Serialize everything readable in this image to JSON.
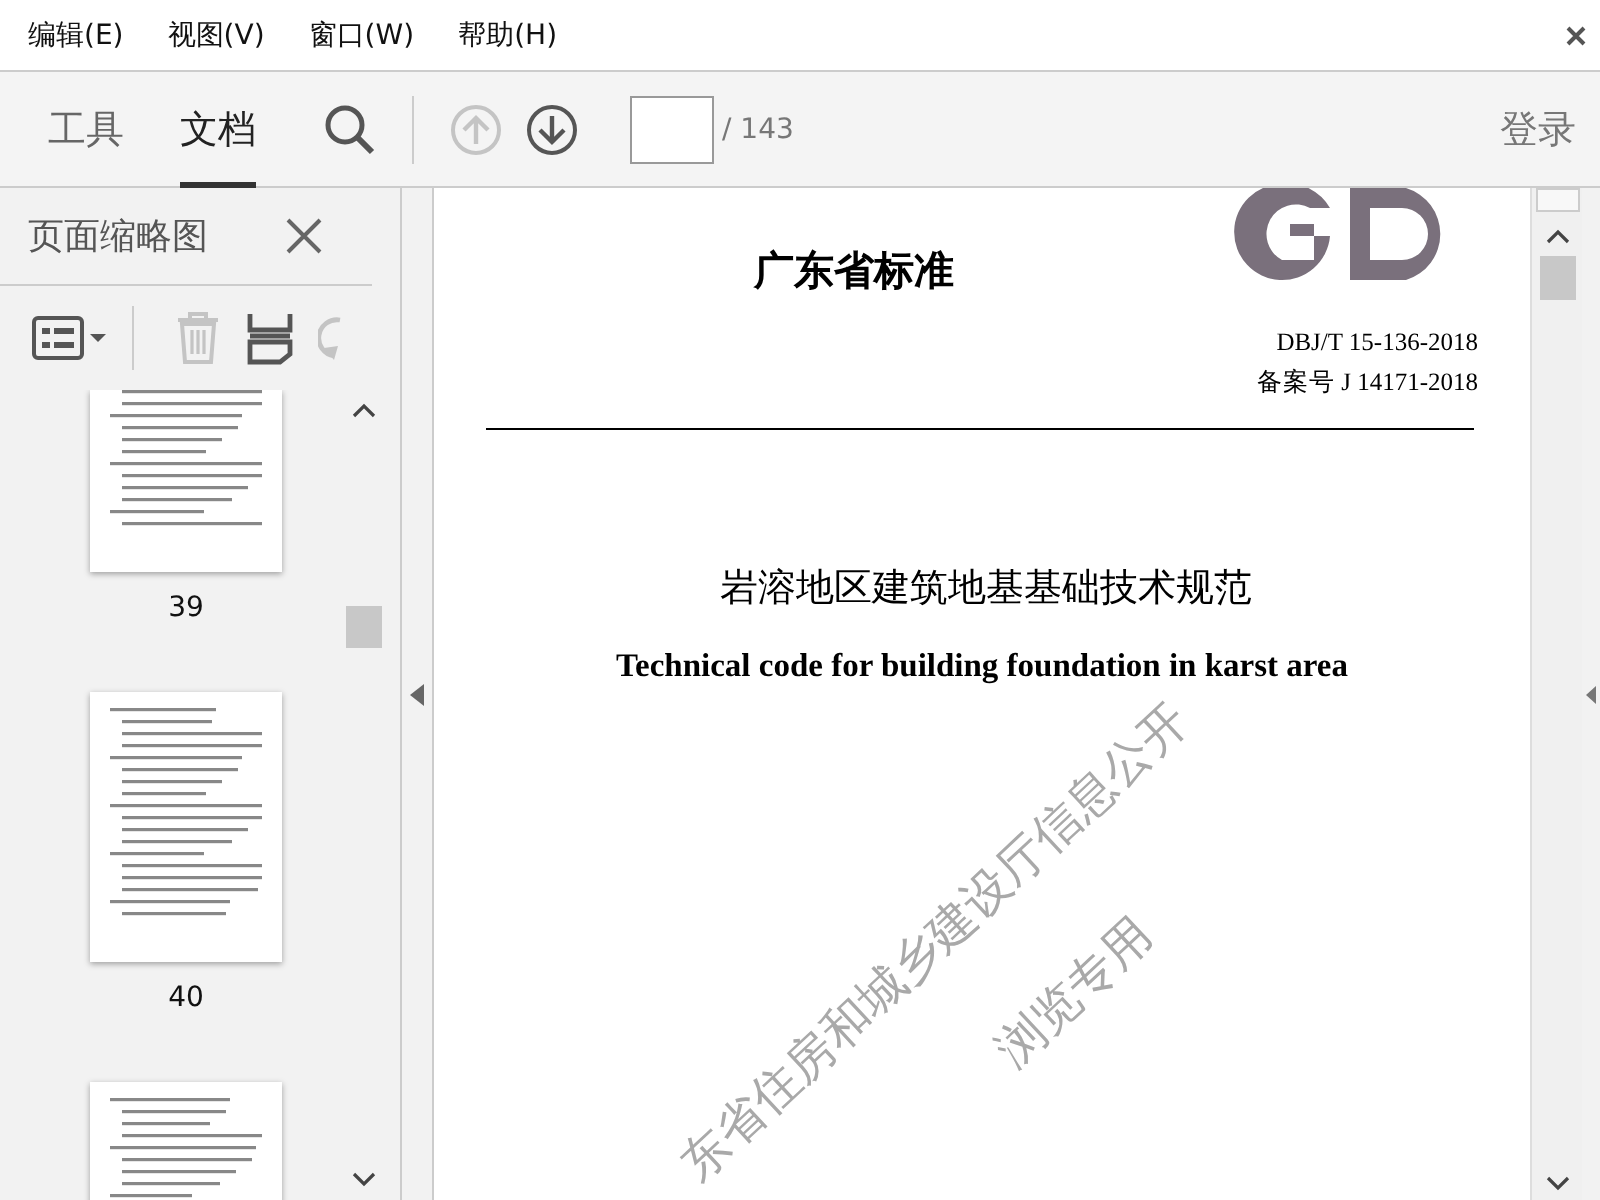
{
  "menu": [
    {
      "label": "编辑(E)"
    },
    {
      "label": "视图(V)"
    },
    {
      "label": "窗口(W)"
    },
    {
      "label": "帮助(H)"
    }
  ],
  "toolbar": {
    "tabs": [
      {
        "label": "工具",
        "selected": false
      },
      {
        "label": "文档",
        "selected": true
      }
    ],
    "prev_page_disabled": true,
    "next_page_disabled": false,
    "page_total": "/ 143",
    "login": "登录"
  },
  "thumbnails_panel": {
    "title": "页面缩略图",
    "delete_disabled": true,
    "rotate_disabled": true,
    "pages": [
      {
        "label": "39"
      },
      {
        "label": "40"
      }
    ]
  },
  "document": {
    "heading": "广东省标准",
    "code": "DBJ/T 15-136-2018",
    "record": "备案号 J 14171-2018",
    "title_zh": "岩溶地区建筑地基基础技术规范",
    "title_en": "Technical code for building foundation in karst area",
    "watermark": [
      "东省住房和城乡建设厅信息公开",
      "浏览专用"
    ]
  }
}
